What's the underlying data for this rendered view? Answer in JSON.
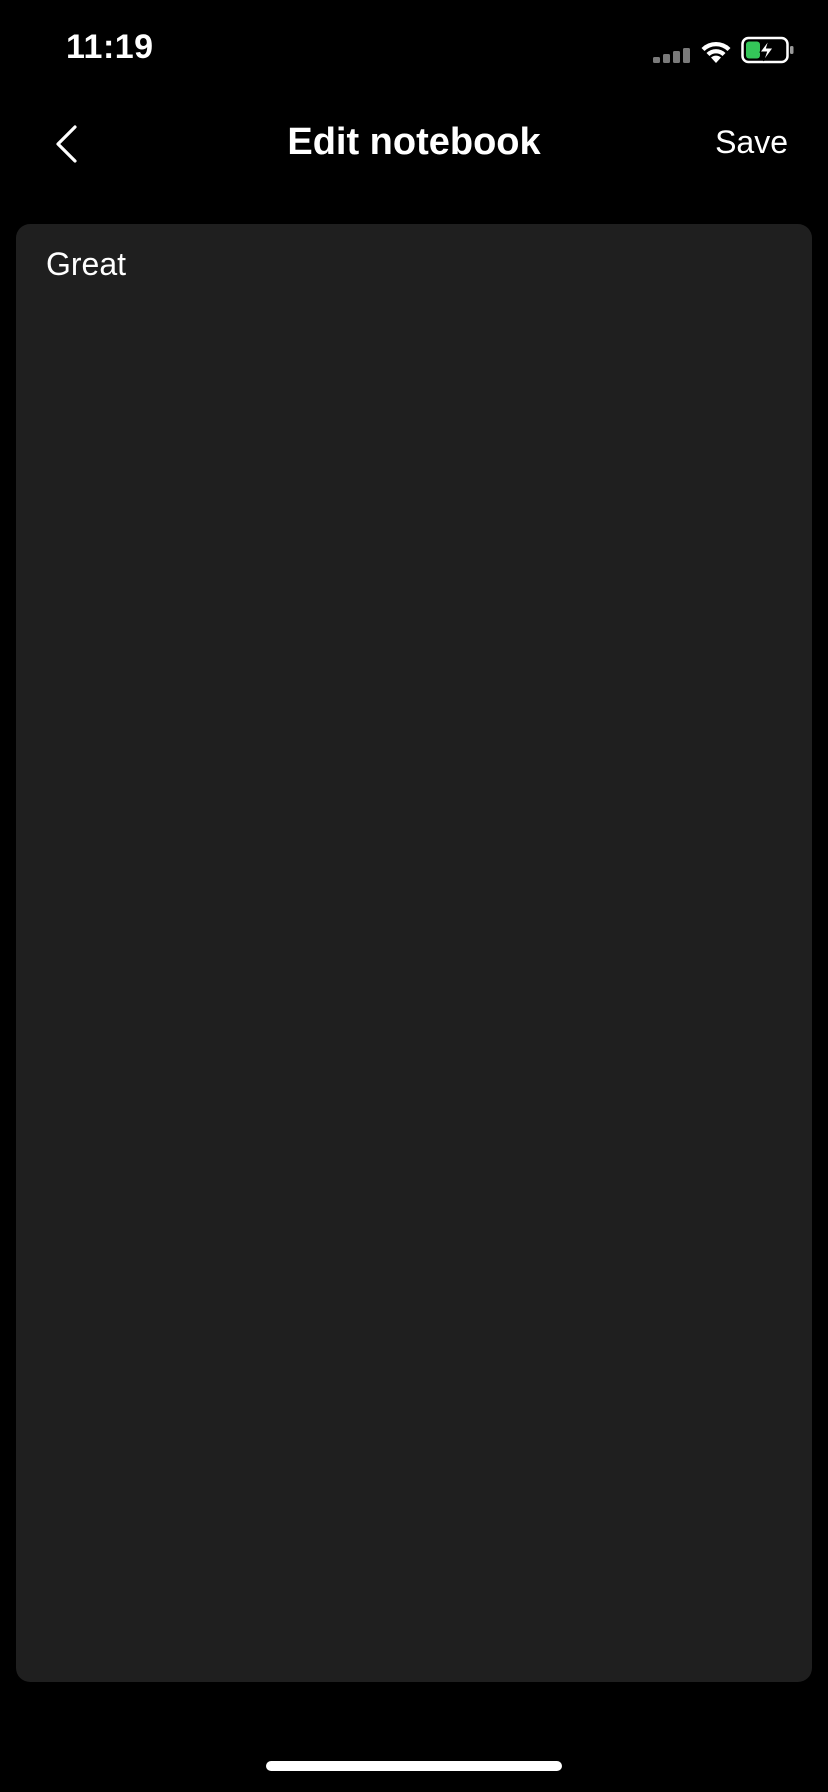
{
  "status_bar": {
    "time": "11:19",
    "icons": {
      "signal": "cellular-signal-icon",
      "wifi": "wifi-icon",
      "battery": "battery-charging-icon"
    },
    "battery_color": "#34c759"
  },
  "nav": {
    "title": "Edit notebook",
    "save_label": "Save",
    "back_icon": "chevron-left-icon"
  },
  "editor": {
    "value": "Great",
    "background": "#1f1f1f"
  }
}
